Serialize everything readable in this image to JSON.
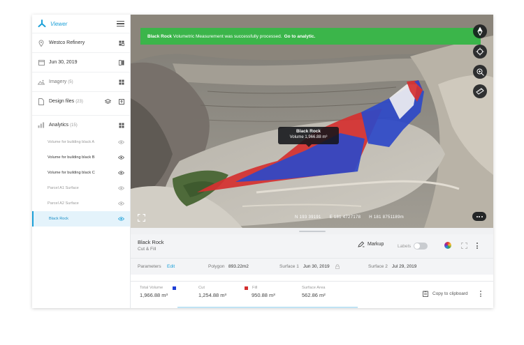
{
  "app": {
    "title": "Viewer"
  },
  "sidebar": {
    "items": [
      {
        "label": "Westco Refinery",
        "icon": "pin-icon"
      },
      {
        "label": "Jun 30, 2019",
        "icon": "calendar-icon"
      },
      {
        "label": "Imagery",
        "count": "(5)",
        "icon": "image-icon"
      },
      {
        "label": "Design files",
        "count": "(23)",
        "icon": "file-icon"
      },
      {
        "label": "Analytics",
        "count": "(15)",
        "icon": "chart-icon"
      }
    ],
    "analytics_items": [
      {
        "label": "Volume for building black A",
        "state": "dim"
      },
      {
        "label": "Volume for building black B",
        "state": "normal"
      },
      {
        "label": "Volume for building black C",
        "state": "normal"
      },
      {
        "label": "Parcel A1 Surface",
        "state": "dim"
      },
      {
        "label": "Parcel A2 Surface",
        "state": "dim"
      },
      {
        "label": "Black Rock",
        "state": "active"
      }
    ]
  },
  "banner": {
    "name": "Black Rock",
    "message": "Volumetric Measurement was successfully processed.",
    "link": "Go to analytic."
  },
  "tooltip": {
    "title": "Black Rock",
    "volume": "Volume 1,966.88 m³"
  },
  "coords": {
    "n": "N 193 39191",
    "e": "E 181 4727178",
    "h": "H 181 8751189m"
  },
  "panel": {
    "title": "Black Rock",
    "subtitle": "Cut & Fill",
    "markup_label": "Markup",
    "labels_label": "Labels",
    "parameters_label": "Parameters",
    "edit_label": "Edit",
    "polygon_label": "Polygon",
    "polygon_value": "893.22m2",
    "surface1_label": "Surface 1",
    "surface1_value": "Jun 30, 2019",
    "surface2_label": "Surface 2",
    "surface2_value": "Jul 29, 2019",
    "copy_label": "Copy to clipboard",
    "stats": [
      {
        "label": "Total Volume",
        "value": "1,966.88 m³",
        "swatch": "#1f3fd6"
      },
      {
        "label": "Cut",
        "value": "1,254.88 m³",
        "swatch": ""
      },
      {
        "label": "Fill",
        "value": "950.88 m³",
        "swatch": "#d32f2f"
      },
      {
        "label": "Surface Area",
        "value": "562.86 m²",
        "swatch": ""
      }
    ]
  },
  "colors": {
    "accent": "#1ba0d8",
    "success": "#3bb54a",
    "cut": "#1f3fd6",
    "fill": "#d32f2f"
  }
}
